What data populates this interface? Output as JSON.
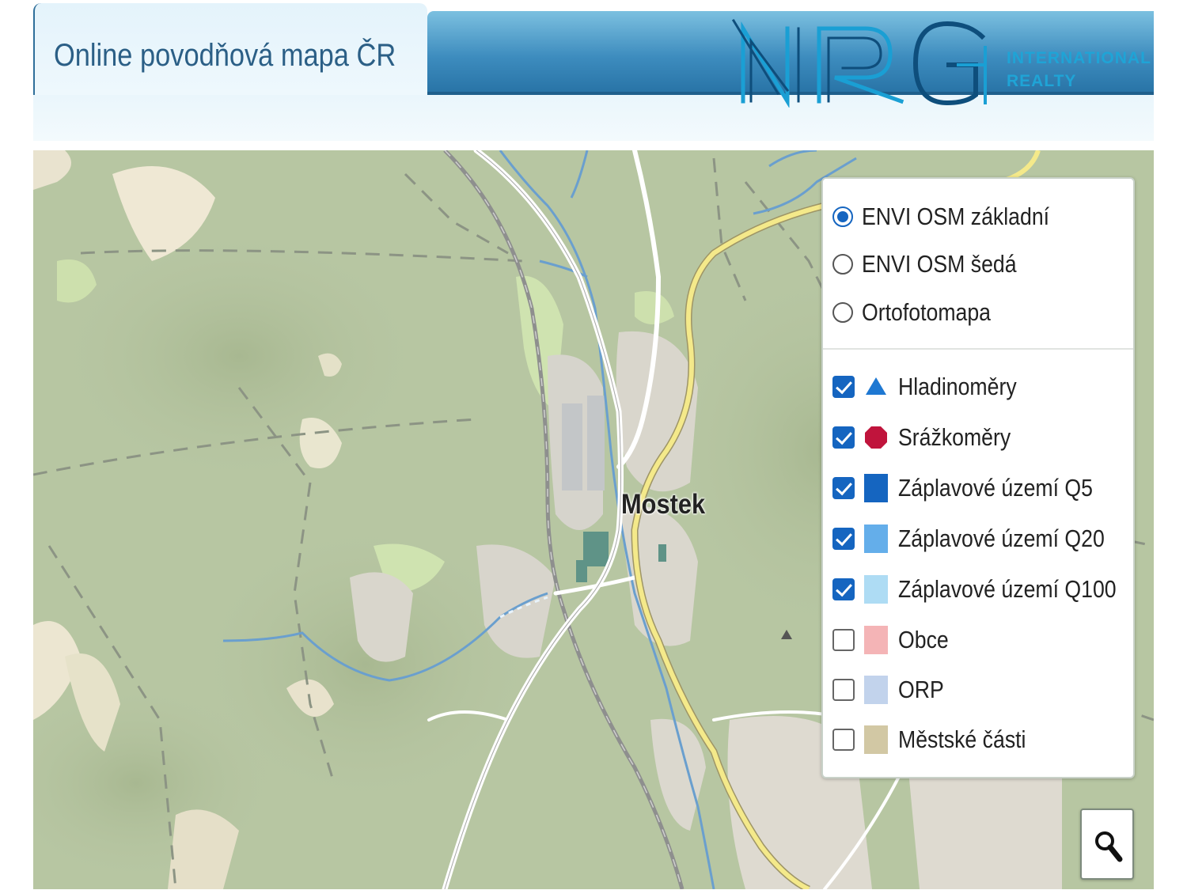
{
  "header": {
    "title": "Online povodňová mapa ČR",
    "logo": {
      "mark": "NRG",
      "tagline_1": "INTERNATIONAL",
      "tagline_2": "REALTY"
    }
  },
  "map": {
    "town_label": "Mostek"
  },
  "layers": {
    "base": [
      {
        "label": "ENVI OSM základní",
        "selected": true
      },
      {
        "label": "ENVI OSM šedá",
        "selected": false
      },
      {
        "label": "Ortofotomapa",
        "selected": false
      }
    ],
    "overlays": [
      {
        "label": "Hladinoměry",
        "checked": true,
        "icon": "triangle-icon",
        "color": "#1e78d2"
      },
      {
        "label": "Srážkoměry",
        "checked": true,
        "icon": "octagon-icon",
        "color": "#c0143c"
      },
      {
        "label": "Záplavové území Q5",
        "checked": true,
        "icon": "square-swatch",
        "color": "#1565c0"
      },
      {
        "label": "Záplavové území Q20",
        "checked": true,
        "icon": "square-swatch",
        "color": "#64aeea"
      },
      {
        "label": "Záplavové území Q100",
        "checked": true,
        "icon": "square-swatch",
        "color": "#aedcf4"
      },
      {
        "label": "Obce",
        "checked": false,
        "icon": "square-swatch",
        "color": "#f4b4b6"
      },
      {
        "label": "ORP",
        "checked": false,
        "icon": "square-swatch",
        "color": "#c2d3ec"
      },
      {
        "label": "Městské části",
        "checked": false,
        "icon": "square-swatch",
        "color": "#d2c8a4"
      }
    ]
  },
  "controls": {
    "search_icon": "magnifier-icon"
  }
}
